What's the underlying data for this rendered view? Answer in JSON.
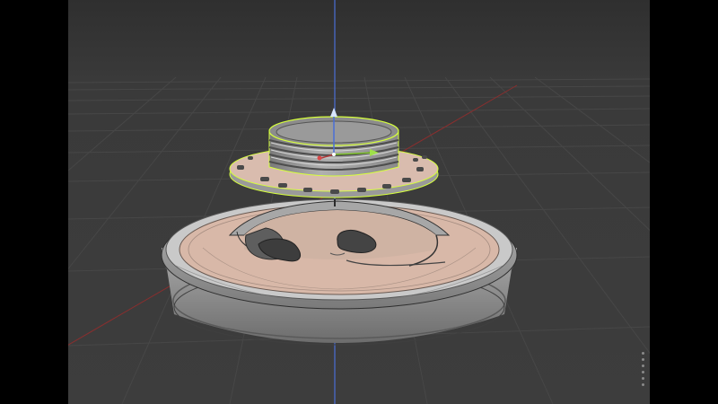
{
  "app": {
    "window": "3D Viewport",
    "mode": "object-mode"
  },
  "scene": {
    "objects": [
      {
        "name": "threaded-collar",
        "selected": true,
        "outline_color": "#d6ff3c"
      },
      {
        "name": "flange-ring",
        "selected": true,
        "outline_color": "#d6ff3c"
      },
      {
        "name": "base-plate",
        "selected": false
      }
    ],
    "gizmo": {
      "type": "transform-gizmo",
      "axes": [
        "x",
        "y",
        "z"
      ]
    },
    "colors": {
      "background": "#3a3a3a",
      "grid": "#4a4a4a",
      "floor_grid": "#3f3f3f",
      "x_axis": "#b03a3a",
      "y_axis": "#7cbf2a",
      "z_axis": "#4a6fd6",
      "selection": "#d6ff3c",
      "surface_top": "#d8b8a8",
      "surface_side": "#a8a8a8"
    }
  }
}
